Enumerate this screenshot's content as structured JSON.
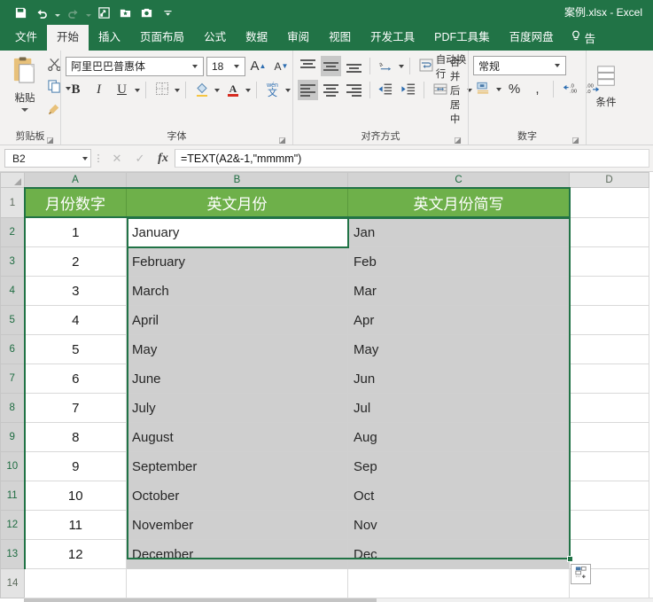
{
  "titlebar": {
    "document_title": "案例.xlsx - Excel",
    "quick_access": [
      {
        "name": "save-icon",
        "label": "保存"
      },
      {
        "name": "undo-icon",
        "label": "撤销"
      },
      {
        "name": "redo-icon",
        "label": "恢复"
      },
      {
        "name": "export-icon",
        "label": "导出"
      },
      {
        "name": "favorite-box-icon",
        "label": "收藏"
      },
      {
        "name": "camera-icon",
        "label": "截图"
      },
      {
        "name": "customize-qat-icon",
        "label": "自定义快速访问工具栏"
      }
    ]
  },
  "tabs": [
    {
      "label": "文件",
      "active": false
    },
    {
      "label": "开始",
      "active": true
    },
    {
      "label": "插入",
      "active": false
    },
    {
      "label": "页面布局",
      "active": false
    },
    {
      "label": "公式",
      "active": false
    },
    {
      "label": "数据",
      "active": false
    },
    {
      "label": "审阅",
      "active": false
    },
    {
      "label": "视图",
      "active": false
    },
    {
      "label": "开发工具",
      "active": false
    },
    {
      "label": "PDF工具集",
      "active": false
    },
    {
      "label": "百度网盘",
      "active": false
    }
  ],
  "tell_me": "告",
  "ribbon": {
    "clipboard": {
      "label": "剪贴板",
      "paste_label": "粘贴",
      "cut_label": "剪切",
      "copy_label": "复制",
      "format_painter_label": "格式刷"
    },
    "font": {
      "label": "字体",
      "font_name": "阿里巴巴普惠体",
      "font_size": "18",
      "grow_label": "A",
      "shrink_label": "A",
      "bold_label": "B",
      "italic_label": "I",
      "underline_label": "U",
      "borders_label": "边框",
      "fill_color_label": "填充颜色",
      "font_color_label": "字体颜色",
      "phonetic_label": "wén 文"
    },
    "alignment": {
      "label": "对齐方式",
      "wrap_text_label": "自动换行",
      "merge_center_label": "合并后居中",
      "orientation_label": "方向",
      "indent_decrease_label": "减少缩进量",
      "indent_increase_label": "增加缩进量"
    },
    "number": {
      "label": "数字",
      "format_value": "常规",
      "accounting_label": "会计数字格式",
      "percent_label": "%",
      "comma_label": ",",
      "increase_decimal_label": ".00",
      "decrease_decimal_label": ".00"
    },
    "styles": {
      "label": "条件",
      "conditional_label": "条件"
    }
  },
  "formula_bar": {
    "name_box": "B2",
    "cancel_label": "✕",
    "enter_label": "✓",
    "fx_label": "fx",
    "formula": "=TEXT(A2&-1,\"mmmm\")"
  },
  "sheet": {
    "column_headers": [
      {
        "label": "A",
        "selected": true
      },
      {
        "label": "B",
        "selected": true
      },
      {
        "label": "C",
        "selected": true
      },
      {
        "label": "D",
        "selected": false
      }
    ],
    "row_headers": [
      "1",
      "2",
      "3",
      "4",
      "5",
      "6",
      "7",
      "8",
      "9",
      "10",
      "11",
      "12",
      "13",
      "14"
    ],
    "header_row": {
      "a": "月份数字",
      "b": "英文月份",
      "c": "英文月份简写"
    },
    "rows": [
      {
        "row": "2",
        "a": "1",
        "b": "January",
        "c": "Jan"
      },
      {
        "row": "3",
        "a": "2",
        "b": "February",
        "c": "Feb"
      },
      {
        "row": "4",
        "a": "3",
        "b": "March",
        "c": "Mar"
      },
      {
        "row": "5",
        "a": "4",
        "b": "April",
        "c": "Apr"
      },
      {
        "row": "6",
        "a": "5",
        "b": "May",
        "c": "May"
      },
      {
        "row": "7",
        "a": "6",
        "b": "June",
        "c": "Jun"
      },
      {
        "row": "8",
        "a": "7",
        "b": "July",
        "c": "Jul"
      },
      {
        "row": "9",
        "a": "8",
        "b": "August",
        "c": "Aug"
      },
      {
        "row": "10",
        "a": "9",
        "b": "September",
        "c": "Sep"
      },
      {
        "row": "11",
        "a": "10",
        "b": "October",
        "c": "Oct"
      },
      {
        "row": "12",
        "a": "11",
        "b": "November",
        "c": "Nov"
      },
      {
        "row": "13",
        "a": "12",
        "b": "December",
        "c": "Dec"
      }
    ],
    "active_cell": "B2",
    "selection_range": "B2:C13",
    "smart_tag": "quick-analysis"
  },
  "colors": {
    "brand_green": "#217346",
    "header_fill": "#6eb04a",
    "selection_fill": "#cfcfcf",
    "ribbon_bg": "#f3f2f1"
  }
}
